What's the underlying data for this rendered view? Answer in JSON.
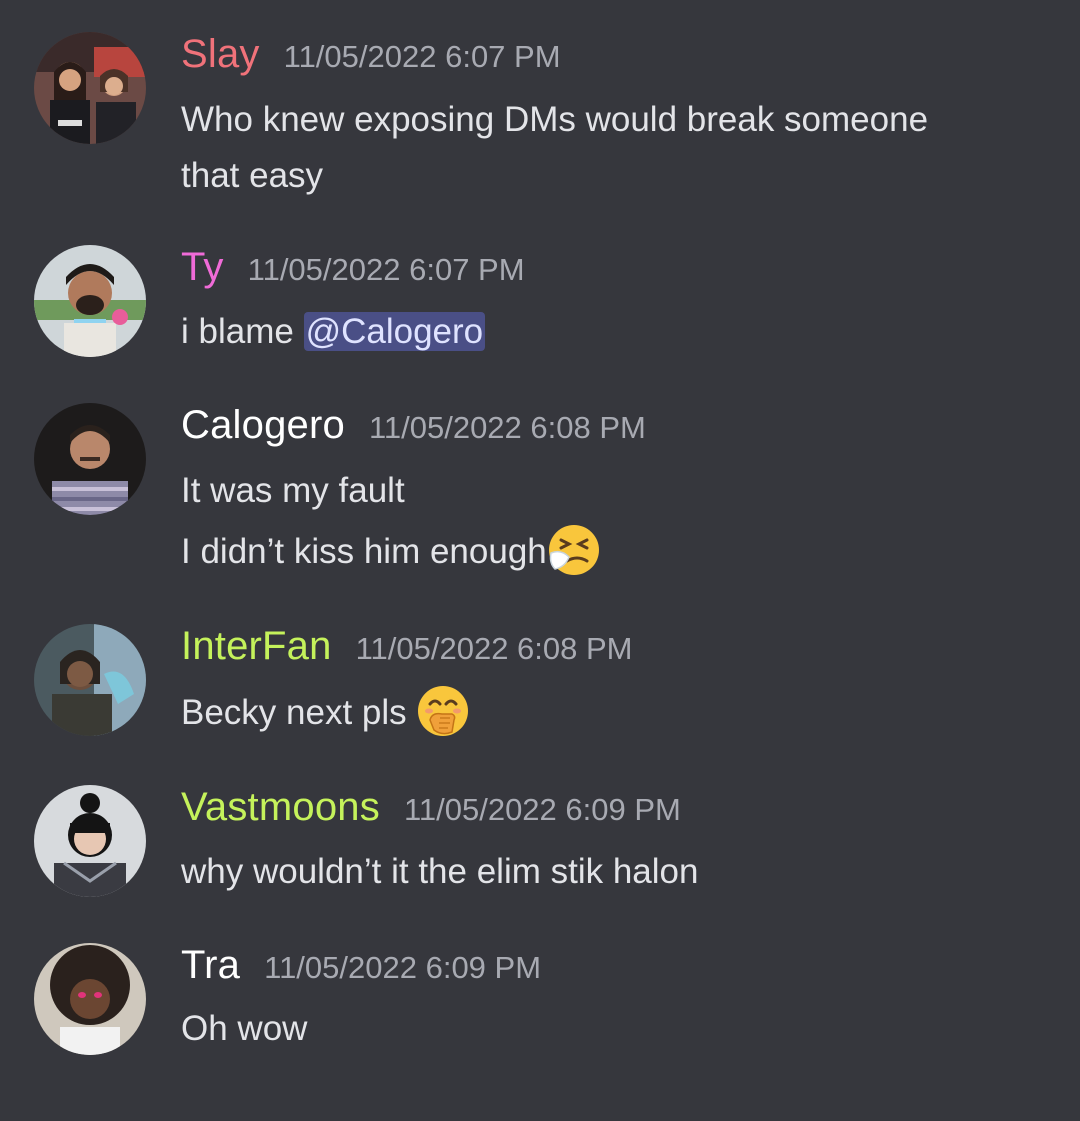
{
  "colors": {
    "background": "#36373d",
    "slay": "#f0727a",
    "ty": "#f06bd8",
    "calogero": "#ffffff",
    "interfan": "#c5f25b",
    "vastmoons": "#c5f25b",
    "tra": "#ffffff",
    "timestamp": "#a8aab2",
    "mention_bg": "#4a4f86"
  },
  "messages": [
    {
      "username": "Slay",
      "timestamp": "11/05/2022 6:07 PM",
      "lines": [
        "Who knew exposing DMs would break someone",
        "that easy"
      ],
      "avatar": "avatar-slay"
    },
    {
      "username": "Ty",
      "timestamp": "11/05/2022 6:07 PM",
      "text_prefix": "i blame ",
      "mention": "@Calogero",
      "avatar": "avatar-ty"
    },
    {
      "username": "Calogero",
      "timestamp": "11/05/2022 6:08 PM",
      "lines": [
        "It was my fault",
        "I didn’t kiss him enough"
      ],
      "emoji": "sneezing-face-emoji",
      "avatar": "avatar-calogero"
    },
    {
      "username": "InterFan",
      "timestamp": "11/05/2022 6:08 PM",
      "lines": [
        "Becky next pls "
      ],
      "emoji": "hand-over-mouth-emoji",
      "avatar": "avatar-interfan"
    },
    {
      "username": "Vastmoons",
      "timestamp": "11/05/2022 6:09 PM",
      "lines": [
        "why wouldn’t it the elim stik halon"
      ],
      "avatar": "avatar-vastmoons"
    },
    {
      "username": "Tra",
      "timestamp": "11/05/2022 6:09 PM",
      "lines": [
        "Oh wow"
      ],
      "avatar": "avatar-tra"
    }
  ]
}
